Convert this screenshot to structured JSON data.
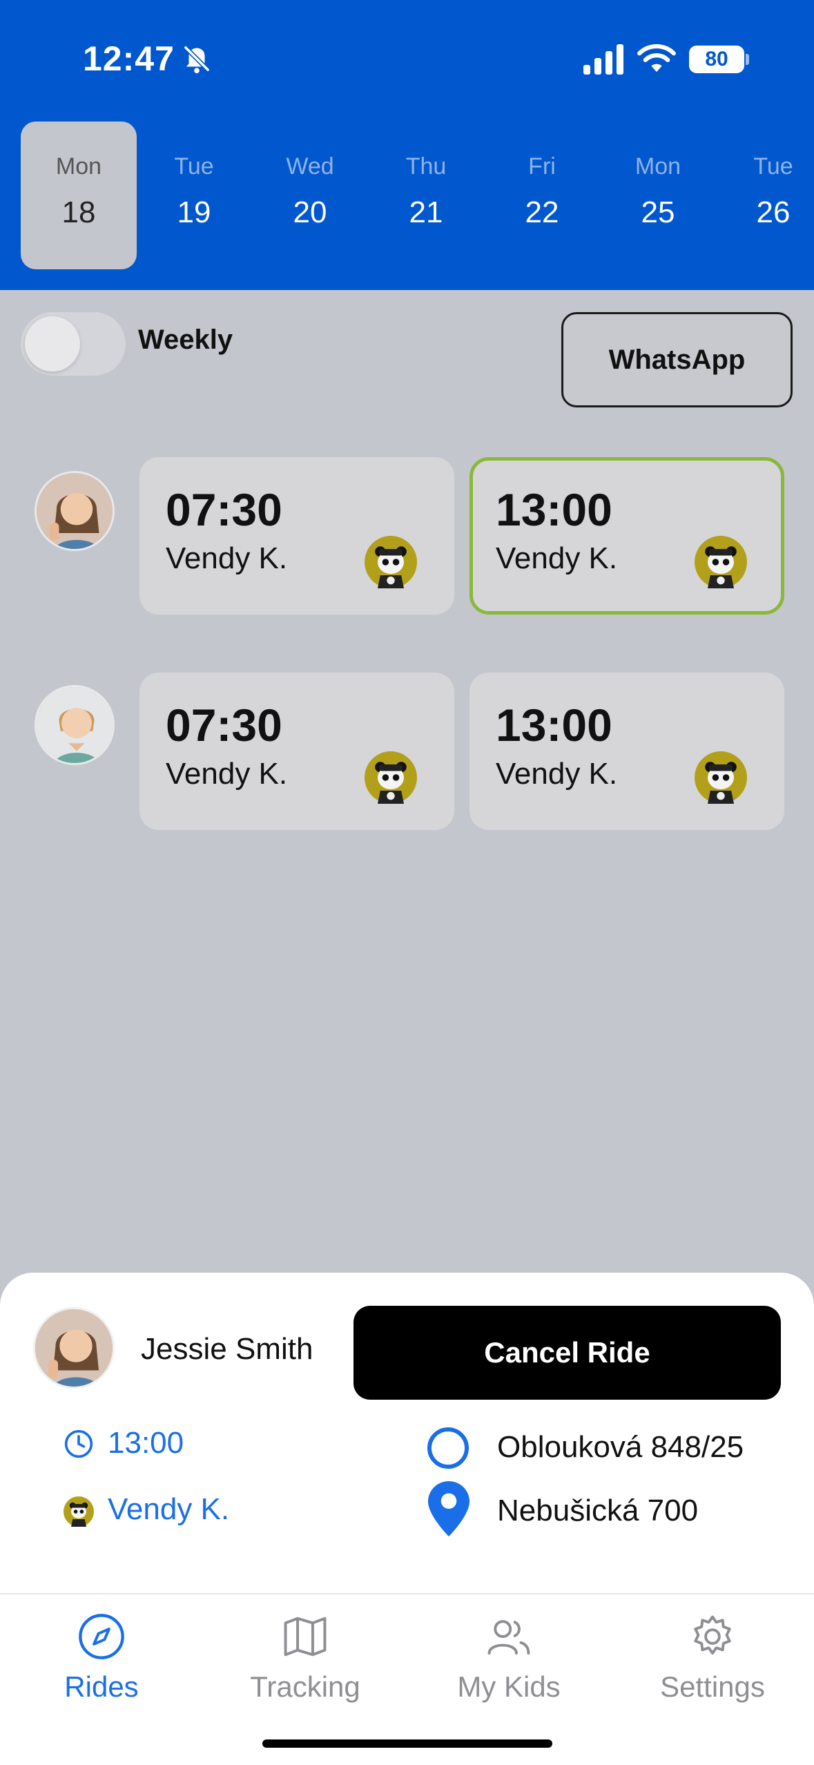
{
  "status_bar": {
    "time": "12:47",
    "battery": "80"
  },
  "days": [
    {
      "name": "Mon",
      "num": "18",
      "selected": true
    },
    {
      "name": "Tue",
      "num": "19"
    },
    {
      "name": "Wed",
      "num": "20"
    },
    {
      "name": "Thu",
      "num": "21"
    },
    {
      "name": "Fri",
      "num": "22"
    },
    {
      "name": "Mon",
      "num": "25"
    },
    {
      "name": "Tue",
      "num": "26"
    }
  ],
  "controls": {
    "weekly_label": "Weekly",
    "weekly_on": false,
    "whatsapp_label": "WhatsApp"
  },
  "rides": [
    {
      "cards": [
        {
          "time": "07:30",
          "driver": "Vendy K."
        },
        {
          "time": "13:00",
          "driver": "Vendy K.",
          "selected": true
        }
      ]
    },
    {
      "cards": [
        {
          "time": "07:30",
          "driver": "Vendy K."
        },
        {
          "time": "13:00",
          "driver": "Vendy K."
        }
      ]
    }
  ],
  "details": {
    "kid_name": "Jessie Smith",
    "cancel_label": "Cancel Ride",
    "time": "13:00",
    "driver": "Vendy K.",
    "origin": "Oblouková 848/25",
    "destination": "Nebušická 700"
  },
  "tabs": [
    {
      "label": "Rides",
      "icon": "compass-icon",
      "active": true
    },
    {
      "label": "Tracking",
      "icon": "map-icon"
    },
    {
      "label": "My Kids",
      "icon": "users-icon"
    },
    {
      "label": "Settings",
      "icon": "gear-icon"
    }
  ],
  "colors": {
    "primary": "#0157ce",
    "accent": "#1a6fe8",
    "selected_border": "#8ab83a",
    "background": "#c4c6ce"
  }
}
